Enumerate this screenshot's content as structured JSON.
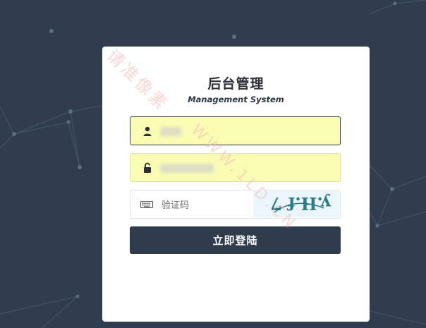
{
  "login": {
    "title": "后台管理",
    "subtitle": "Management System",
    "captcha_placeholder": "验证码",
    "submit_label": "立即登陆",
    "captcha_text": "y.H.f 7"
  },
  "watermark": {
    "cn": "请准像素",
    "url": "WWW.1LD.CN"
  },
  "icons": {
    "username": "user-icon",
    "password": "lock-icon",
    "captcha": "keyboard-icon"
  },
  "colors": {
    "background": "#2f3d4f",
    "button": "#2f3c4b",
    "autofill": "#fafcb4"
  }
}
